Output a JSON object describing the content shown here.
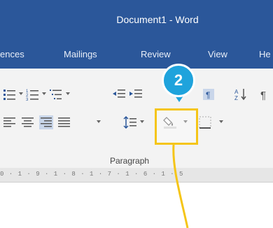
{
  "window": {
    "title": "Document1  -  Word"
  },
  "tabs": [
    {
      "label": "ences"
    },
    {
      "label": "Mailings"
    },
    {
      "label": "Review"
    },
    {
      "label": "View"
    },
    {
      "label": "He"
    }
  ],
  "ribbon": {
    "group_label": "Paragraph",
    "highlighted_control": "shading-icon"
  },
  "ruler": {
    "text": "0 · 1 · 9 · 1 · 8 · 1 · 7 · 1 · 6 · 1 · 5"
  },
  "callout": {
    "step_number": "2",
    "color": "#1fa3dc",
    "highlight_color": "#f5c518"
  }
}
